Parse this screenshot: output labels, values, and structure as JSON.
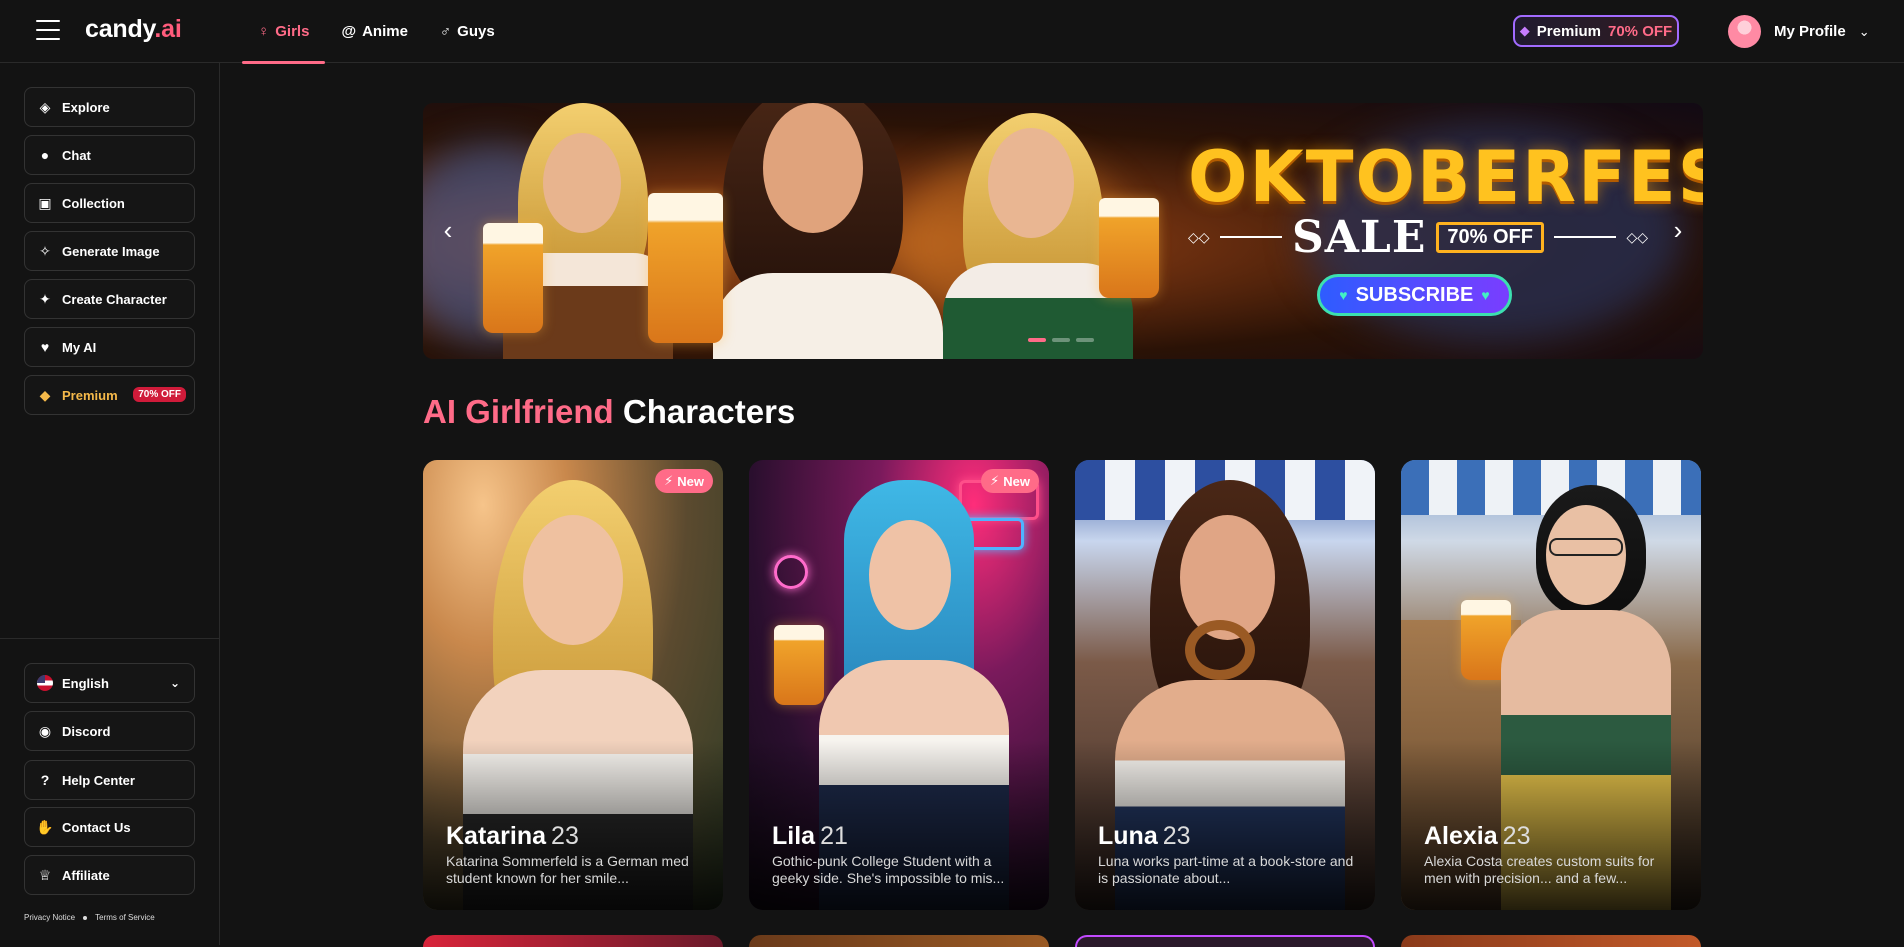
{
  "header": {
    "logo_main": "candy",
    "logo_suffix": ".ai",
    "tabs": [
      {
        "label": "Girls",
        "icon": "female-icon",
        "active": true
      },
      {
        "label": "Anime",
        "icon": "swirl-icon",
        "active": false
      },
      {
        "label": "Guys",
        "icon": "male-icon",
        "active": false
      }
    ],
    "premium_label": "Premium",
    "premium_off": "70% OFF",
    "profile_label": "My Profile"
  },
  "sidebar": {
    "items": [
      {
        "label": "Explore",
        "icon": "compass-icon"
      },
      {
        "label": "Chat",
        "icon": "chat-bubble-icon"
      },
      {
        "label": "Collection",
        "icon": "gallery-icon"
      },
      {
        "label": "Generate Image",
        "icon": "image-sparkle-icon"
      },
      {
        "label": "Create Character",
        "icon": "magic-wand-icon"
      },
      {
        "label": "My AI",
        "icon": "hearts-icon"
      },
      {
        "label": "Premium",
        "icon": "diamond-icon",
        "badge": "70% OFF"
      }
    ],
    "bottom_items": [
      {
        "label": "English",
        "icon": "us-flag-icon"
      },
      {
        "label": "Discord",
        "icon": "discord-icon"
      },
      {
        "label": "Help Center",
        "icon": "question-icon"
      },
      {
        "label": "Contact Us",
        "icon": "handshake-icon"
      },
      {
        "label": "Affiliate",
        "icon": "trophy-icon"
      }
    ],
    "footer_links": [
      "Privacy Notice",
      "Terms of Service"
    ]
  },
  "banner": {
    "title": "OKTOBERFEST",
    "sale": "SALE",
    "sale_badge": "70% OFF",
    "cta": "SUBSCRIBE",
    "slides_count": 3,
    "active_slide": 1
  },
  "section": {
    "title_highlight": "AI Girlfriend",
    "title_rest": "Characters"
  },
  "characters": [
    {
      "name": "Katarina",
      "age": "23",
      "desc": "Katarina Sommerfeld is a German med student known for her smile...",
      "badge": "New"
    },
    {
      "name": "Lila",
      "age": "21",
      "desc": "Gothic-punk College Student with a geeky side. She's impossible to mis...",
      "badge": "New"
    },
    {
      "name": "Luna",
      "age": "23",
      "desc": "Luna works part-time at a book-store and is passionate about...",
      "badge": ""
    },
    {
      "name": "Alexia",
      "age": "23",
      "desc": "Alexia Costa creates custom suits for men with precision... and a few...",
      "badge": ""
    }
  ],
  "colors": {
    "accent": "#ff6b88",
    "background": "#131313",
    "premium_gold": "#f5b94a",
    "banner_title": "#ffc21f"
  }
}
